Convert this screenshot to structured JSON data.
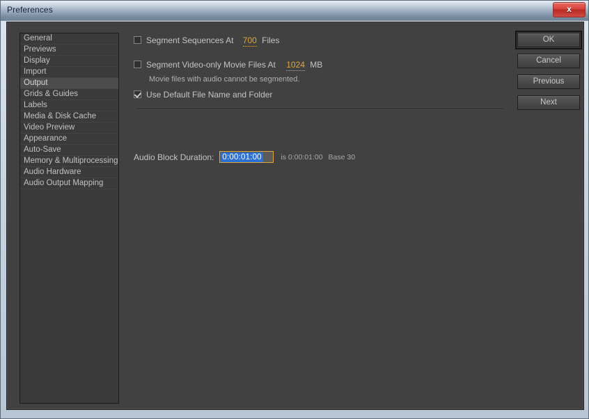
{
  "window": {
    "title": "Preferences",
    "close_icon": "close-icon",
    "close_glyph": "x"
  },
  "sidebar": {
    "items": [
      {
        "label": "General",
        "selected": false
      },
      {
        "label": "Previews",
        "selected": false
      },
      {
        "label": "Display",
        "selected": false
      },
      {
        "label": "Import",
        "selected": false
      },
      {
        "label": "Output",
        "selected": true
      },
      {
        "label": "Grids & Guides",
        "selected": false
      },
      {
        "label": "Labels",
        "selected": false
      },
      {
        "label": "Media & Disk Cache",
        "selected": false
      },
      {
        "label": "Video Preview",
        "selected": false
      },
      {
        "label": "Appearance",
        "selected": false
      },
      {
        "label": "Auto-Save",
        "selected": false
      },
      {
        "label": "Memory & Multiprocessing",
        "selected": false
      },
      {
        "label": "Audio Hardware",
        "selected": false
      },
      {
        "label": "Audio Output Mapping",
        "selected": false
      }
    ]
  },
  "options": {
    "segment_sequences": {
      "label": "Segment Sequences At",
      "value": "700",
      "unit": "Files",
      "checked": false
    },
    "segment_video_only": {
      "label": "Segment Video-only Movie Files At",
      "value": "1024",
      "unit": "MB",
      "checked": false
    },
    "note": "Movie files with audio cannot be segmented.",
    "use_default_name": {
      "label": "Use Default File Name and Folder",
      "checked": true
    },
    "audio_block_duration": {
      "label": "Audio Block Duration:",
      "value": "0:00:01:00",
      "suffix": "is 0:00:01:00",
      "base": "Base 30"
    }
  },
  "buttons": [
    {
      "label": "OK",
      "default": true
    },
    {
      "label": "Cancel",
      "default": false
    },
    {
      "label": "Previous",
      "default": false
    },
    {
      "label": "Next",
      "default": false
    }
  ],
  "colors": {
    "accent_value": "#e0a73c",
    "selection": "#2a6fd4",
    "panel_bg": "#414141",
    "list_bg": "#3a3a3a"
  }
}
